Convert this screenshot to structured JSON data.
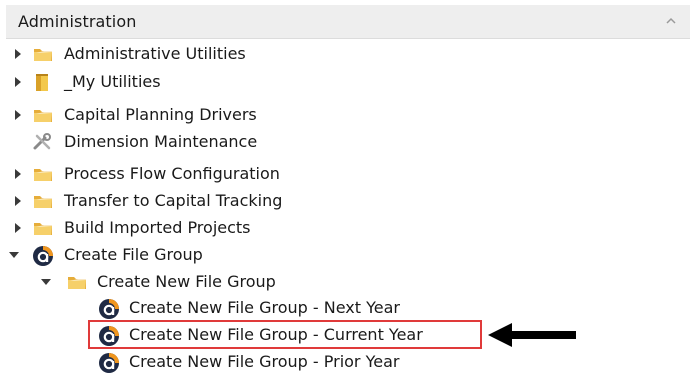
{
  "panel": {
    "title": "Administration"
  },
  "tree": {
    "items": [
      {
        "label": "Administrative Utilities",
        "icon": "folder-icon"
      },
      {
        "label": "_My Utilities",
        "icon": "folder-closed-icon"
      },
      {
        "label": "Capital Planning Drivers",
        "icon": "folder-icon"
      },
      {
        "label": "Dimension Maintenance",
        "icon": "tools-icon"
      },
      {
        "label": "Process Flow Configuration",
        "icon": "folder-icon"
      },
      {
        "label": "Transfer to Capital Tracking",
        "icon": "folder-icon"
      },
      {
        "label": "Build Imported Projects",
        "icon": "folder-icon"
      },
      {
        "label": "Create File Group",
        "icon": "app-logo-icon"
      },
      {
        "label": "Create New File Group",
        "icon": "folder-icon"
      },
      {
        "label": "Create New File Group - Next Year",
        "icon": "app-logo-icon"
      },
      {
        "label": "Create New File Group - Current Year",
        "icon": "app-logo-icon",
        "highlighted": true
      },
      {
        "label": "Create New File Group - Prior Year",
        "icon": "app-logo-icon"
      }
    ]
  },
  "colors": {
    "highlight_border": "#e03a3a",
    "folder": "#f2c14e",
    "logo_orange": "#f0961e",
    "logo_dark": "#1f2a44"
  }
}
